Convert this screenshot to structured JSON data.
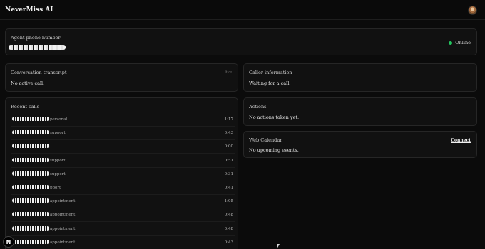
{
  "app": {
    "title": "NeverMiss AI"
  },
  "agent": {
    "label": "Agent phone number",
    "status": "Online"
  },
  "transcript": {
    "title": "Conversation transcript",
    "badge": "live",
    "body": "No active call."
  },
  "caller": {
    "title": "Caller information",
    "body": "Waiting for a call."
  },
  "recent": {
    "title": "Recent calls",
    "rows": [
      {
        "tag": "personal",
        "duration": "1:17"
      },
      {
        "tag": "support",
        "duration": "0:43"
      },
      {
        "tag": "",
        "duration": "0:00"
      },
      {
        "tag": "support",
        "duration": "0:51"
      },
      {
        "tag": "support",
        "duration": "0:31"
      },
      {
        "tag": "pport",
        "duration": "0:41"
      },
      {
        "tag": "appointment",
        "duration": "1:05"
      },
      {
        "tag": "appointment",
        "duration": "0:48"
      },
      {
        "tag": "appointment",
        "duration": "0:48"
      },
      {
        "tag": "appointment",
        "duration": "0:43"
      }
    ]
  },
  "actions": {
    "title": "Actions",
    "body": "No actions taken yet."
  },
  "calendar": {
    "title": "Web Calendar",
    "connect_label": "Connect",
    "body": "No upcoming events."
  },
  "badge": {
    "letter": "N"
  },
  "colors": {
    "online": "#22c55e",
    "background": "#0b0b0b",
    "card": "#111111"
  }
}
